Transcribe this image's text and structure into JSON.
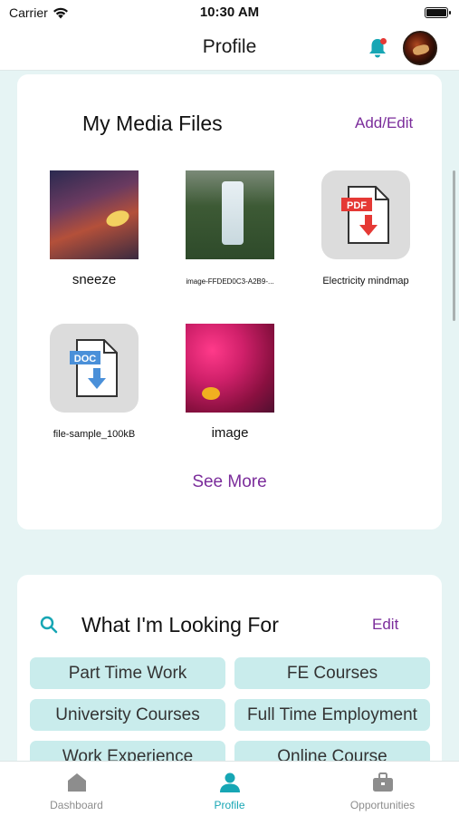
{
  "status_bar": {
    "carrier": "Carrier",
    "time": "10:30 AM"
  },
  "header": {
    "title": "Profile"
  },
  "media_files": {
    "title": "My Media Files",
    "action": "Add/Edit",
    "items": [
      {
        "label": "sneeze",
        "icon": "image-thumbnail"
      },
      {
        "label": "image-FFDED0C3-A2B9-...",
        "icon": "image-thumbnail"
      },
      {
        "label": "Electricity mindmap",
        "icon": "pdf-icon",
        "badge": "PDF"
      },
      {
        "label": "file-sample_100kB",
        "icon": "doc-icon",
        "badge": "DOC"
      },
      {
        "label": "image",
        "icon": "image-thumbnail"
      }
    ],
    "see_more": "See More"
  },
  "looking_for": {
    "title": "What I'm Looking For",
    "action": "Edit",
    "tags": [
      "Part Time Work",
      "FE Courses",
      "University Courses",
      "Full Time Employment",
      "Work Experience",
      "Online Course"
    ]
  },
  "tab_bar": {
    "tabs": [
      {
        "label": "Dashboard",
        "icon": "home-icon"
      },
      {
        "label": "Profile",
        "icon": "person-icon",
        "active": true
      },
      {
        "label": "Opportunities",
        "icon": "briefcase-icon"
      }
    ]
  },
  "colors": {
    "accent": "#17a6b4",
    "link": "#7b2d9b",
    "tag_bg": "#c9ecec",
    "notification": "#e53935"
  }
}
